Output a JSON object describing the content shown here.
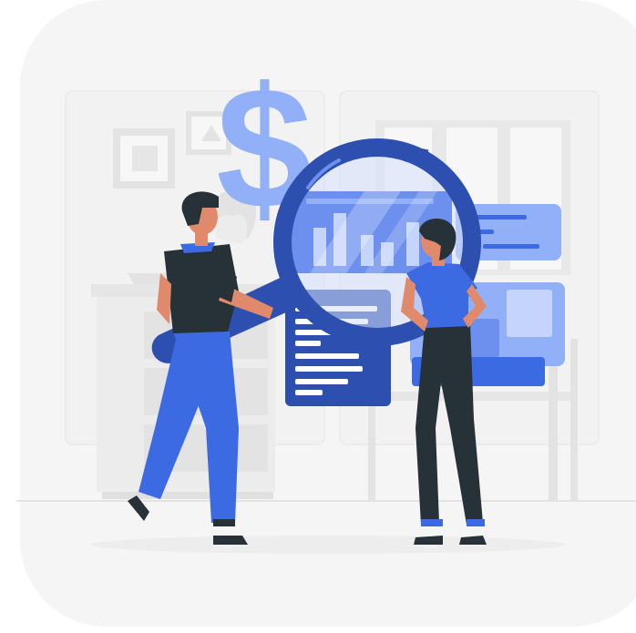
{
  "illustration": {
    "icons": [
      "dollar-sign-icon",
      "magnifying-glass-icon",
      "bar-chart-icon",
      "document-icon"
    ],
    "colors": {
      "card_background": "#f5f5f5",
      "accent_blue": "#3b6ae3",
      "light_blue": "#92b0f7",
      "dark_blue": "#2c4fb0",
      "dark_clothing": "#263238",
      "skin": "#e08a6b",
      "hair": "#263238",
      "furniture_gray": "#ebebeb"
    }
  }
}
